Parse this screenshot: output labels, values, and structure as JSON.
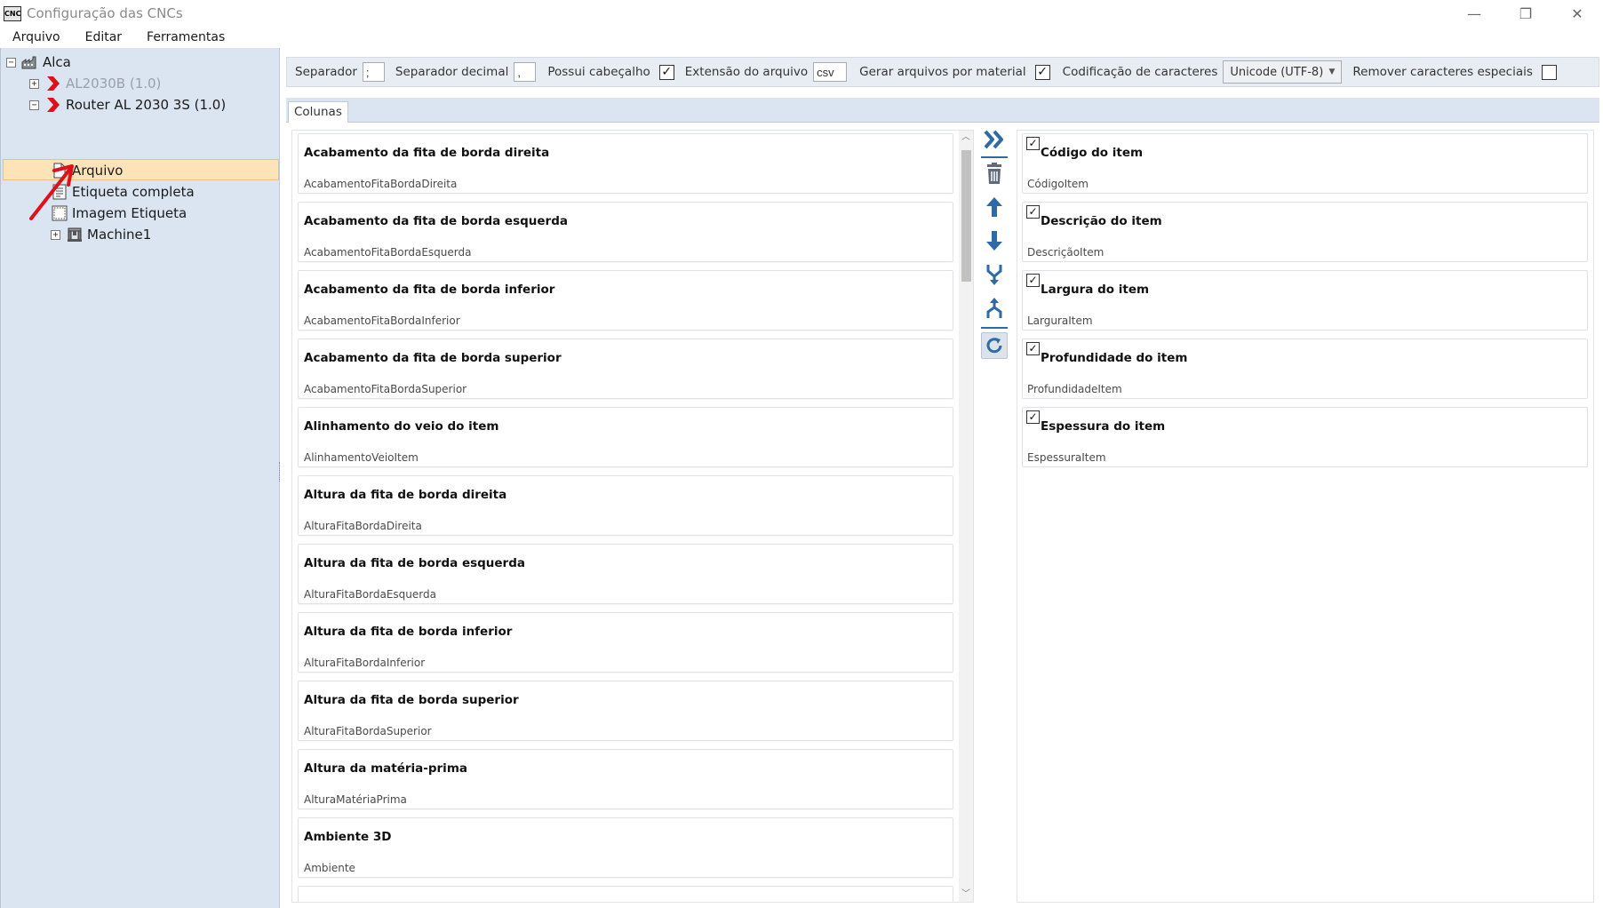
{
  "window": {
    "icon_text": "CNC",
    "title": "Configuração das CNCs",
    "minimize_glyph": "—",
    "restore_glyph": "❐",
    "close_glyph": "✕"
  },
  "menu": {
    "items": [
      "Arquivo",
      "Editar",
      "Ferramentas"
    ]
  },
  "tree": {
    "root": {
      "label": "Alca",
      "expander": "−",
      "icon": "factory-icon"
    },
    "machines": [
      {
        "label": "AL2030B (1.0)",
        "expander": "+",
        "icon": "red-chevron-icon",
        "disabled": true
      },
      {
        "label": "Router AL 2030 3S (1.0)",
        "expander": "−",
        "icon": "red-chevron-icon",
        "disabled": false
      }
    ],
    "children": [
      {
        "label": "Arquivo",
        "icon": "file-icon",
        "selected": true
      },
      {
        "label": "Etiqueta completa",
        "icon": "label-icon",
        "selected": false
      },
      {
        "label": "Imagem Etiqueta",
        "icon": "image-label-icon",
        "selected": false
      },
      {
        "label": "Machine1",
        "icon": "machine-icon",
        "expander": "+",
        "selected": false
      }
    ]
  },
  "options": {
    "separator_label": "Separador",
    "separator_value": ";",
    "decimal_separator_label": "Separador decimal",
    "decimal_separator_value": ",",
    "has_header_label": "Possui cabeçalho",
    "has_header_checked": true,
    "extension_label": "Extensão do arquivo",
    "extension_value": "csv",
    "files_per_material_label": "Gerar arquivos por material",
    "files_per_material_checked": true,
    "encoding_label": "Codificação de caracteres",
    "encoding_value": "Unicode (UTF-8)",
    "remove_special_label": "Remover caracteres especiais",
    "remove_special_checked": false,
    "check_glyph": "✓"
  },
  "tabs": [
    {
      "label": "Colunas",
      "active": true
    }
  ],
  "available_columns": [
    {
      "title": "Acabamento da fita de borda direita",
      "key": "AcabamentoFitaBordaDireita"
    },
    {
      "title": "Acabamento da fita de borda esquerda",
      "key": "AcabamentoFitaBordaEsquerda"
    },
    {
      "title": "Acabamento da fita de borda inferior",
      "key": "AcabamentoFitaBordaInferior"
    },
    {
      "title": "Acabamento da fita de borda superior",
      "key": "AcabamentoFitaBordaSuperior"
    },
    {
      "title": "Alinhamento do veio do item",
      "key": "AlinhamentoVeioItem"
    },
    {
      "title": "Altura da fita de borda direita",
      "key": "AlturaFitaBordaDireita"
    },
    {
      "title": "Altura da fita de borda esquerda",
      "key": "AlturaFitaBordaEsquerda"
    },
    {
      "title": "Altura da fita de borda inferior",
      "key": "AlturaFitaBordaInferior"
    },
    {
      "title": "Altura da fita de borda superior",
      "key": "AlturaFitaBordaSuperior"
    },
    {
      "title": "Altura da matéria-prima",
      "key": "AlturaMatériaPrima"
    },
    {
      "title": "Ambiente 3D",
      "key": "Ambiente"
    }
  ],
  "selected_columns": [
    {
      "title": "Código do item",
      "key": "CódigoItem",
      "checked": true
    },
    {
      "title": "Descrição do item",
      "key": "DescriçãoItem",
      "checked": true
    },
    {
      "title": "Largura do item",
      "key": "LarguraItem",
      "checked": true
    },
    {
      "title": "Profundidade do item",
      "key": "ProfundidadeItem",
      "checked": true
    },
    {
      "title": "Espessura do item",
      "key": "EspessuraItem",
      "checked": true
    }
  ],
  "actions": [
    "add-all-icon",
    "delete-icon",
    "move-up-icon",
    "move-down-icon",
    "merge-icon",
    "split-icon",
    "refresh-icon"
  ],
  "scroll": {
    "up_glyph": "︿",
    "down_glyph": "﹀"
  },
  "colors": {
    "tree_background": "#dbe5f2",
    "selection": "#fde4b8",
    "action_blue": "#2e6aa6",
    "arrow_red": "#e0101a"
  }
}
